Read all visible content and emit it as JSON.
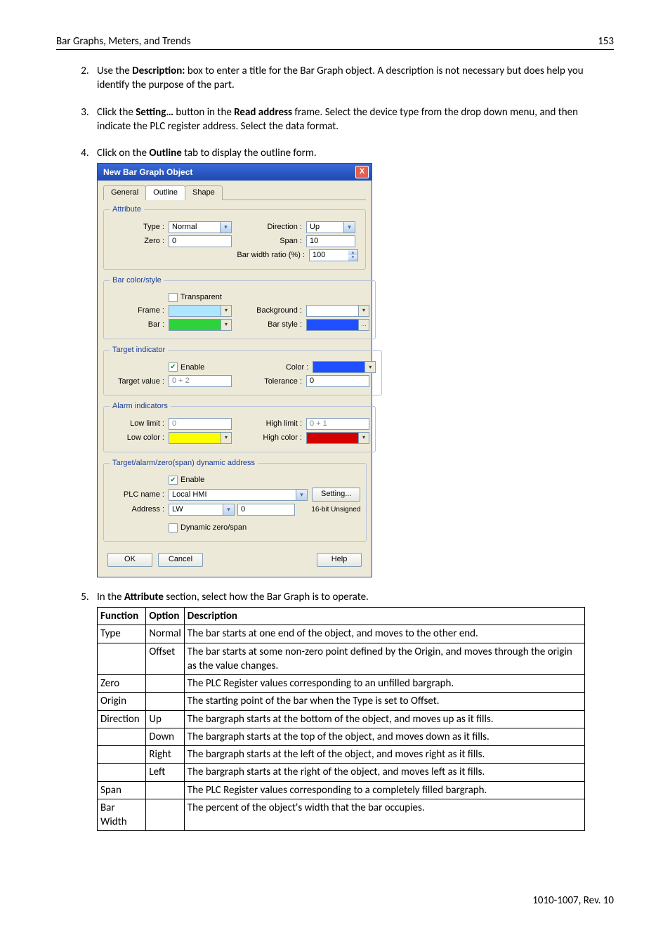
{
  "header": {
    "title": "Bar Graphs, Meters, and Trends",
    "pageNum": "153"
  },
  "steps": {
    "s2": {
      "num": "2.",
      "pre": "Use the ",
      "b1": "Description:",
      "post": " box to enter a title for the Bar Graph object. A description is not necessary but does help you identify the purpose of the part."
    },
    "s3": {
      "num": "3.",
      "pre": "Click the ",
      "b1": "Setting…",
      "mid": " button in the ",
      "b2": "Read address",
      "post": " frame. Select the device type from the drop down menu, and then indicate the PLC register address. Select the data format."
    },
    "s4": {
      "num": "4.",
      "pre": "Click on the ",
      "b1": "Outline",
      "post": " tab to display the outline form."
    },
    "s5": {
      "num": "5.",
      "pre": "In the ",
      "b1": "Attribute",
      "post": " section, select how the Bar Graph is to operate."
    }
  },
  "dialog": {
    "title": "New  Bar Graph Object",
    "close": "X",
    "tabs": {
      "general": "General",
      "outline": "Outline",
      "shape": "Shape"
    },
    "attribute": {
      "legend": "Attribute",
      "typeLbl": "Type :",
      "typeVal": "Normal",
      "dirLbl": "Direction :",
      "dirVal": "Up",
      "zeroLbl": "Zero :",
      "zeroVal": "0",
      "spanLbl": "Span :",
      "spanVal": "10",
      "barWidthLbl": "Bar width ratio (%) :",
      "barWidthVal": "100"
    },
    "barColor": {
      "legend": "Bar color/style",
      "transparent": "Transparent",
      "frameLbl": "Frame :",
      "bgLbl": "Background :",
      "barLbl": "Bar :",
      "barStyleLbl": "Bar style :"
    },
    "target": {
      "legend": "Target indicator",
      "enable": "Enable",
      "colorLbl": "Color :",
      "tvLbl": "Target value :",
      "tvVal": "0 + 2",
      "tolLbl": "Tolerance :",
      "tolVal": "0"
    },
    "alarm": {
      "legend": "Alarm indicators",
      "lowLimitLbl": "Low limit :",
      "lowLimitVal": "0",
      "highLimitLbl": "High limit :",
      "highLimitVal": "0 + 1",
      "lowColorLbl": "Low color :",
      "highColorLbl": "High color :"
    },
    "dyn": {
      "legend": "Target/alarm/zero(span) dynamic address",
      "enable": "Enable",
      "plcLbl": "PLC name :",
      "plcVal": "Local HMI",
      "settingBtn": "Setting...",
      "addrLbl": "Address :",
      "addrType": "LW",
      "addrVal": "0",
      "format": "16-bit Unsigned",
      "dynZero": "Dynamic zero/span"
    },
    "buttons": {
      "ok": "OK",
      "cancel": "Cancel",
      "help": "Help"
    }
  },
  "table": {
    "h1": "Function",
    "h2": "Option",
    "h3": "Description",
    "rows": [
      {
        "f": "Type",
        "o": "Normal",
        "d": "The bar starts at one end of the object, and moves to the other end."
      },
      {
        "f": "",
        "o": "Offset",
        "d": "The bar starts at some non-zero point defined by the Origin, and moves through the origin as the value changes."
      },
      {
        "f": "Zero",
        "o": "",
        "d": "The PLC Register values corresponding to an unfilled bargraph."
      },
      {
        "f": "Origin",
        "o": "",
        "d": "The starting point of the bar when the Type is set to Offset."
      },
      {
        "f": "Direction",
        "o": "Up",
        "d": "The bargraph starts at the bottom of the object, and moves up as it fills."
      },
      {
        "f": "",
        "o": "Down",
        "d": "The bargraph starts at the top of the object, and moves down as it fills."
      },
      {
        "f": "",
        "o": "Right",
        "d": "The bargraph starts at the left of the object, and moves right as it fills."
      },
      {
        "f": "",
        "o": "Left",
        "d": "The bargraph starts at the right of the object, and moves left as it fills."
      },
      {
        "f": "Span",
        "o": "",
        "d": "The PLC Register values corresponding to a completely filled bargraph."
      },
      {
        "f": "Bar Width",
        "o": "",
        "d": "The percent of the object's width that the bar occupies."
      }
    ]
  },
  "footer": "1010-1007, Rev. 10"
}
